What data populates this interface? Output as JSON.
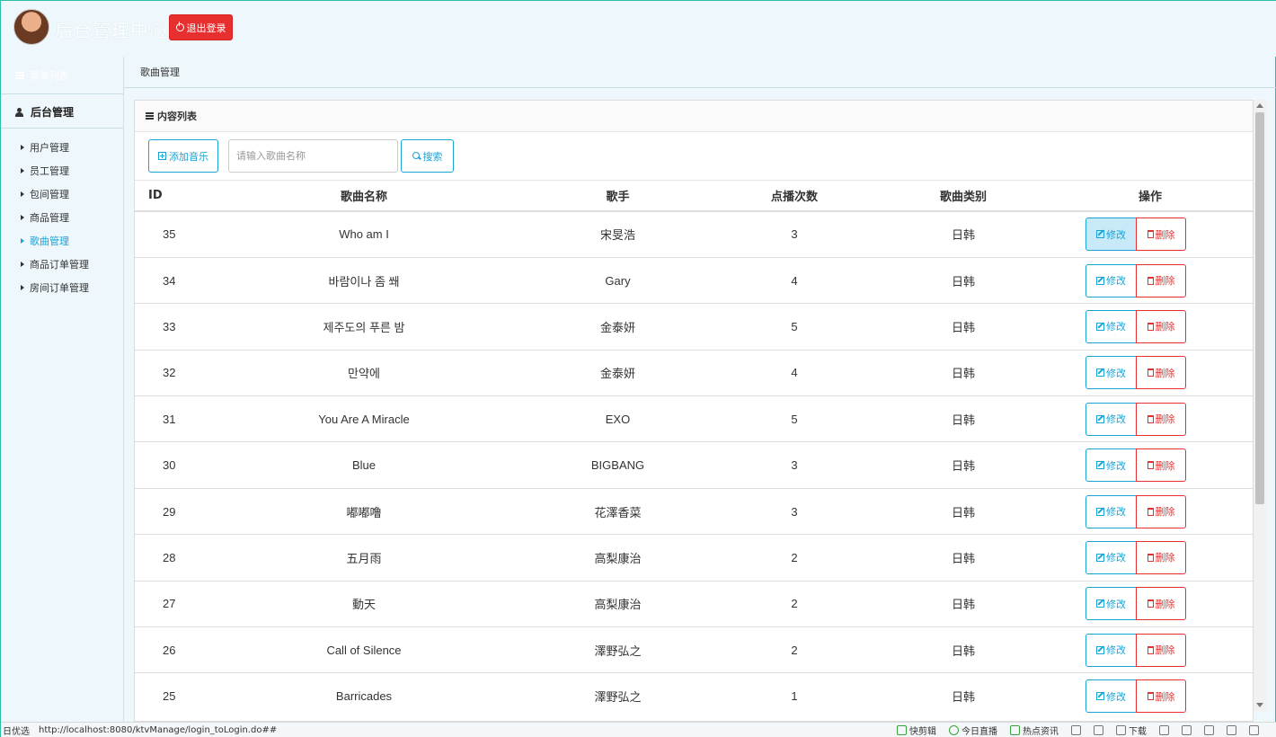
{
  "header": {
    "title": "后台管理中心",
    "logout_label": "退出登录"
  },
  "sidebar": {
    "menu_list_label": "菜单列表",
    "section_label": "后台管理",
    "items": [
      {
        "label": "用户管理",
        "active": false
      },
      {
        "label": "员工管理",
        "active": false
      },
      {
        "label": "包间管理",
        "active": false
      },
      {
        "label": "商品管理",
        "active": false
      },
      {
        "label": "歌曲管理",
        "active": true
      },
      {
        "label": "商品订单管理",
        "active": false
      },
      {
        "label": "房间订单管理",
        "active": false
      }
    ]
  },
  "breadcrumb": "歌曲管理",
  "panel": {
    "title": "内容列表",
    "add_label": "添加音乐",
    "search_placeholder": "请输入歌曲名称",
    "search_label": "搜索"
  },
  "table": {
    "columns": [
      "ID",
      "歌曲名称",
      "歌手",
      "点播次数",
      "歌曲类别",
      "操作"
    ],
    "edit_label": "修改",
    "delete_label": "删除",
    "rows": [
      {
        "id": "35",
        "name": "Who am I",
        "singer": "宋旻浩",
        "plays": "3",
        "category": "日韩"
      },
      {
        "id": "34",
        "name": "바람이나 좀 쐐",
        "singer": "Gary",
        "plays": "4",
        "category": "日韩"
      },
      {
        "id": "33",
        "name": "제주도의 푸른 밤",
        "singer": "金泰妍",
        "plays": "5",
        "category": "日韩"
      },
      {
        "id": "32",
        "name": "만약에",
        "singer": "金泰妍",
        "plays": "4",
        "category": "日韩"
      },
      {
        "id": "31",
        "name": "You Are A Miracle",
        "singer": "EXO",
        "plays": "5",
        "category": "日韩"
      },
      {
        "id": "30",
        "name": "Blue",
        "singer": "BIGBANG",
        "plays": "3",
        "category": "日韩"
      },
      {
        "id": "29",
        "name": "嘟嘟噜",
        "singer": "花澤香菜",
        "plays": "3",
        "category": "日韩"
      },
      {
        "id": "28",
        "name": "五月雨",
        "singer": "高梨康治",
        "plays": "2",
        "category": "日韩"
      },
      {
        "id": "27",
        "name": "動天",
        "singer": "高梨康治",
        "plays": "2",
        "category": "日韩"
      },
      {
        "id": "26",
        "name": "Call of Silence",
        "singer": "澤野弘之",
        "plays": "2",
        "category": "日韩"
      },
      {
        "id": "25",
        "name": "Barricades",
        "singer": "澤野弘之",
        "plays": "1",
        "category": "日韩"
      }
    ]
  },
  "statusbar": {
    "left_label": "日优选",
    "url": "http://localhost:8080/ktvManage/login_toLogin.do##",
    "items": [
      "快剪辑",
      "今日直播",
      "热点资讯",
      "下载"
    ]
  }
}
